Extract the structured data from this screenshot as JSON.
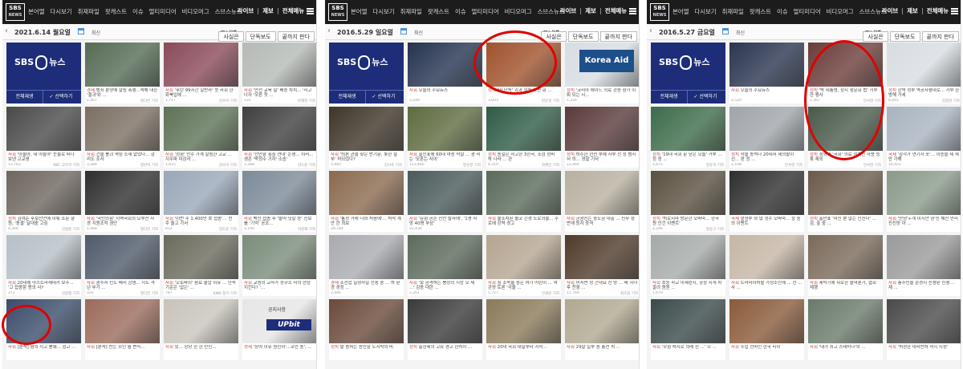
{
  "brand": {
    "logo_top": "SBS",
    "logo_bottom": "NEWS"
  },
  "nav": [
    "본어엘",
    "다시보기",
    "취재파일",
    "팟캐스트",
    "이슈",
    "멀티미디어",
    "비디오머그",
    "스브스뉴스"
  ],
  "right_nav": {
    "live": "라이브",
    "tip": "제보",
    "all_menu": "전체메뉴"
  },
  "datebar": {
    "latest": "최신",
    "corner": "코너별",
    "filters": [
      "사실은",
      "단독보도",
      "끝까지 판다"
    ]
  },
  "sbs8": {
    "title_left": "SBS",
    "title_right": "뉴스",
    "play_all": "전체재생",
    "select_play": "✓ 선택하기"
  },
  "panels": [
    {
      "date": "2021.6.14 월요일",
      "cards": [
        {
          "cat": "경제",
          "cap": "범죄 분양에 살림 폭행...책해 대한 '결과'위 ...",
          "views": "1,407",
          "rep": "정다은 기자",
          "bg": "#556b55"
        },
        {
          "cat": "사회",
          "cap": "'후탄 99시간 일반라' 뜻 라회 한 화북입에 ...",
          "views": "1,717",
          "rep": "김수미 기자",
          "bg": "#8a4a5a"
        },
        {
          "cat": "사회",
          "cap": "'안전 교육 밀' 배송 차치... '사고 나자 '모른 첫 ...",
          "views": "535",
          "rep": "박재현 기자",
          "bg": "#b5bab6"
        },
        {
          "cat": "사회",
          "cap": "'아들아, 내 아들아' 눈물로 떠나 보낸 고교생",
          "views": "13,783",
          "rep": "KBC 고우리 기자",
          "bg": "#4a4a4a"
        },
        {
          "cat": "사회",
          "cap": "건물 붕괴 책임 소재 없었다... 감리도 조사",
          "views": "3,384",
          "rep": "정반석 기자",
          "bg": "#7b6f62"
        },
        {
          "cat": "사회",
          "cap": "'정화' 안수 가계 살림한 고교 ... 지우파 미감사 ...",
          "views": "1,615",
          "rep": "김보미 기자",
          "bg": "#5d7256"
        },
        {
          "cat": "사회",
          "cap": "'천안함 폭침 연대' 논쟁... 이러... 생존 '박정수 기자' 소송'",
          "views": "1,288",
          "rep": "김도윤 기자",
          "bg": "#3f3f3f"
        },
        {
          "cat": "정치",
          "cap": "김여준 후보선언에 이뤄 조문 향 원, '동결' 달대중 고심",
          "views": "4,366",
          "rep": "김형준 기자",
          "bg": "#6e665f"
        },
        {
          "cat": "사회",
          "cap": "'국민의힘' 지역국회의 오부산 사 경 지원조적 권단",
          "views": "1,984",
          "rep": "정다은 기자",
          "bg": "#2e2e2e"
        },
        {
          "cat": "사회",
          "cap": "'이번 주 1,400만 호 접종'... 전 주 돌고 가서",
          "views": "812",
          "rep": "김도윤 기자",
          "bg": "#9aa7b8"
        },
        {
          "cat": "사회",
          "cap": "백신 접종 후 '할머 닷갈 등' 진보를 '기억' 공조...",
          "views": "1,190",
          "rep": "이현재 기자",
          "bg": "#7c8a98"
        },
        {
          "cat": "사회",
          "cap": "20대에 아스트라제네카 보주... '고 접종함 용의 사?",
          "views": "372",
          "rep": "김원철 기자",
          "bg": "#b6c0c7"
        },
        {
          "cat": "사회",
          "cap": "광주서 신도 배리 감염... 지도 격년 부가 ...",
          "views": "320",
          "rep": "정다은 기자",
          "bg": "#4f5a6a"
        },
        {
          "cat": "사회",
          "cap": "'오토바이' 음료 불압 이유 ... 단속 기준은 '없는' ...",
          "views": "787",
          "rep": "KNN 정기 기자",
          "bg": "#6a6a5c"
        },
        {
          "cat": "사회",
          "cap": "교원의 교사가 정규소 사의 현장 지킨다? '...",
          "views": "",
          "rep": "",
          "bg": "#7a8c7a"
        },
        {
          "cat": "사회",
          "cap": "[분석] 혐의 지고 봉쇄... 검고 ...",
          "views": "",
          "rep": "",
          "bg": "#3b4d6b"
        },
        {
          "cat": "사회",
          "cap": "[분석] 찬는 모인 월 변식...",
          "views": "",
          "rep": "",
          "bg": "#9b6b5b"
        },
        {
          "cat": "사회",
          "cap": "있... 상당 한 한 만인...",
          "views": "",
          "rep": "",
          "bg": "#c8c4bc"
        },
        {
          "cat": "경제",
          "cap": "'상여 이유 원진외'...코인 송', ...",
          "views": "",
          "rep": "",
          "bg": "#e6e6e6",
          "upbit": "UPbit",
          "notice": "공지사항"
        }
      ]
    },
    {
      "date": "2016.5.29 일요일",
      "cards": [
        {
          "cat": "사회",
          "cap": "오늘의 주요뉴스",
          "views": "3,249",
          "rep": "",
          "bg": "#24334f"
        },
        {
          "cat": "정치",
          "cap": "'어 단독' 괴과 의원 오면 회 ...",
          "views": "3,003",
          "rep": "현순일 기자",
          "bg": "#a0522d"
        },
        {
          "cat": "정치",
          "cap": "'코리아 에이드 의료 관원 참가 이뤄 되는 시...",
          "views": "1,334",
          "rep": "",
          "bg": "#d7dde3",
          "kaid": "Korea Aid"
        },
        {
          "cat": "사회",
          "cap": "'퇴론 관을 찾은 반기문, 롯한 절 부' 처되었다?",
          "views": "5,940",
          "rep": "김사수 기자",
          "bg": "#3e3528"
        },
        {
          "cat": "사회",
          "cap": "홍인표에 60대 여성 악살 ... 광 리는 '모혼는 사이'",
          "views": "113,460",
          "rep": "정유정 기자",
          "bg": "#5e6b3f"
        },
        {
          "cat": "정치",
          "cap": "동일은 서고한 3한국, 조검 정비 하 나라 ... 관",
          "views": "4,319",
          "rep": "최혜민 기자",
          "bg": "#2f5b46"
        },
        {
          "cat": "정치",
          "cap": "하수한 현전 부에 자부 천 정 범시서 의... 경찰 기사",
          "views": "22,469",
          "rep": "",
          "bg": "#5a3a3a"
        },
        {
          "cat": "사회",
          "cap": "'통정 거래 나와 처음에'... 처작 계안 한 최보",
          "views": "29,784",
          "rep": "",
          "bg": "#8a6a4f"
        },
        {
          "cat": "사회",
          "cap": "'유험 공존 진만 발사에', '1명 사망 40명 부상'",
          "views": "22,436",
          "rep": "",
          "bg": "#4a5a5a"
        },
        {
          "cat": "사회",
          "cap": "불조치된 몰코 긴경 도로의물... 주로에 강력 경고",
          "views": "",
          "rep": "",
          "bg": "#5a6a5a"
        },
        {
          "cat": "사회",
          "cap": "긍광진는 중도금 대출 ... 신무 청 반에 등자 증격",
          "views": "",
          "rep": "",
          "bg": "#b8b0a0"
        },
        {
          "cat": "경제",
          "cap": "조선업 일정사일 진중 중 ... 하 된 경 경정 ...",
          "views": "2,446",
          "rep": "",
          "bg": "#a9abb0"
        },
        {
          "cat": "사회",
          "cap": "'보 공격하는 봉정의 지상 오 세 ...' 감동 대한 ...",
          "views": "2,261",
          "rep": "",
          "bg": "#5c6a5c"
        },
        {
          "cat": "사회",
          "cap": "심 조속을 청은 여가 어린이 ... 여 관양 토론 '극을 ...",
          "views": "5,727",
          "rep": "안세원 기자",
          "bg": "#b5a591"
        },
        {
          "cat": "사회",
          "cap": "어서면 정 곤대요 진 양 ... 매 시다 후 천형 ...",
          "views": "11,769",
          "rep": "최호원 기자",
          "bg": "#4f3a2a"
        },
        {
          "cat": "정치",
          "cap": "할 동혀는 원인항 도시락의 비",
          "views": "",
          "rep": "",
          "bg": "#6a4a3a"
        },
        {
          "cat": "정치",
          "cap": "홍헌제의 고유 경고 한치이 ...",
          "views": "",
          "rep": "",
          "bg": "#3a3a3a"
        },
        {
          "cat": "사회",
          "cap": "20대 국회 내일부터 시작...",
          "views": "",
          "rep": "",
          "bg": "#8a7a5a"
        },
        {
          "cat": "사회",
          "cap": "29살 일부 종 통전 치 ...",
          "views": "",
          "rep": "",
          "bg": "#b0a890"
        }
      ]
    },
    {
      "date": "2016.5.27 금요일",
      "cards": [
        {
          "cat": "사회",
          "cap": "오늘의 주요뉴스",
          "views": "2,520",
          "rep": "",
          "bg": "#2a3550"
        },
        {
          "cat": "정치",
          "cap": "'박 대통령, 상시 청문회 법' 거부 한 행사",
          "views": "1,367",
          "rep": "안서현 기자",
          "bg": "#6b3d3a"
        },
        {
          "cat": "정치",
          "cap": "강력 정부 역공자행대로... 거부 한 방해 거세",
          "views": "6,041",
          "rep": "김정현 기자",
          "bg": "#d8dde2"
        },
        {
          "cat": "정치",
          "cap": "'19대 국회 문 닫은 오늘' 거부 ... 정 정 ...",
          "views": "1,675",
          "rep": "정유석 기자",
          "bg": "#3d6b4a"
        },
        {
          "cat": "정치",
          "cap": "작을 동력나 20대서 재의할이 선... 판 정 ...",
          "views": "2,108",
          "rep": "안서현 기자",
          "bg": "#a0a5aa"
        },
        {
          "cat": "정치",
          "cap": "청와대 '국회' 의료 정치인 사용 등록 제외",
          "views": "",
          "rep": "안서현 기자",
          "bg": "#4a5a4a"
        },
        {
          "cat": "국제",
          "cap": "'감각가 연기자 포'... 이승을 제 재 안 가해",
          "views": "16,922",
          "rep": "",
          "bg": "#a9b4c0"
        },
        {
          "cat": "정치",
          "cap": "'히로시마 방문한 오바마... 한국 원 인건 이벤트'",
          "views": "2,246",
          "rep": "정동구 기자",
          "bg": "#5a5040"
        },
        {
          "cat": "국제",
          "cap": "앞정부 와 없 정수 오바마... 장 중 의 이벤트",
          "views": "",
          "rep": "",
          "bg": "#2e2e2e"
        },
        {
          "cat": "정치",
          "cap": "홍만표 '미신 뿐 없는 인진다' ... 검, 출 중 ...",
          "views": "",
          "rep": "",
          "bg": "#6a5a4a"
        },
        {
          "cat": "사회",
          "cap": "'안녕'+걔 이지만 권'진 해산 만리 진진양 아 ...",
          "views": "",
          "rep": "",
          "bg": "#8a9a8a"
        },
        {
          "cat": "사회",
          "cap": "초등 학교 이세란지, 공장 지게 차 깔려 원원 ...",
          "views": "1,670",
          "rep": "",
          "bg": "#a5aaa8"
        },
        {
          "cat": "사회",
          "cap": "트러마이하할 가정소인에 ... 천 ... 사 ...",
          "views": "",
          "rep": "",
          "bg": "#c5b6a5"
        },
        {
          "cat": "사회",
          "cap": "세탁기에 뒤로한 할머분가, 협회 제행",
          "views": "",
          "rep": "",
          "bg": "#7a6a5a"
        },
        {
          "cat": "사회",
          "cap": "총주민을 순경지 진쟁된 진행 ... 제 ...",
          "views": "",
          "rep": "",
          "bg": "#9a9a9a"
        },
        {
          "cat": "사회",
          "cap": "'모험 하지로 의례 진 ...' 으 ...",
          "views": "",
          "rep": "",
          "bg": "#3a4a4a"
        },
        {
          "cat": "사회",
          "cap": "수입 선마인 한국 티이",
          "views": "",
          "rep": "",
          "bg": "#8a5a3a"
        },
        {
          "cat": "사회",
          "cap": "'내가 최고 스테미나'의 ...",
          "views": "",
          "rep": "",
          "bg": "#6a7a6a"
        },
        {
          "cat": "사회",
          "cap": "'허정한 대학찬하 적지 지정'",
          "views": "",
          "rep": "",
          "bg": "#4a4a4a"
        }
      ]
    }
  ],
  "colors": {
    "topbar": "#1c1c1c",
    "sbs_blue": "#1d2d79",
    "category_red": "#c63b3b",
    "highlight": "#e00000"
  }
}
